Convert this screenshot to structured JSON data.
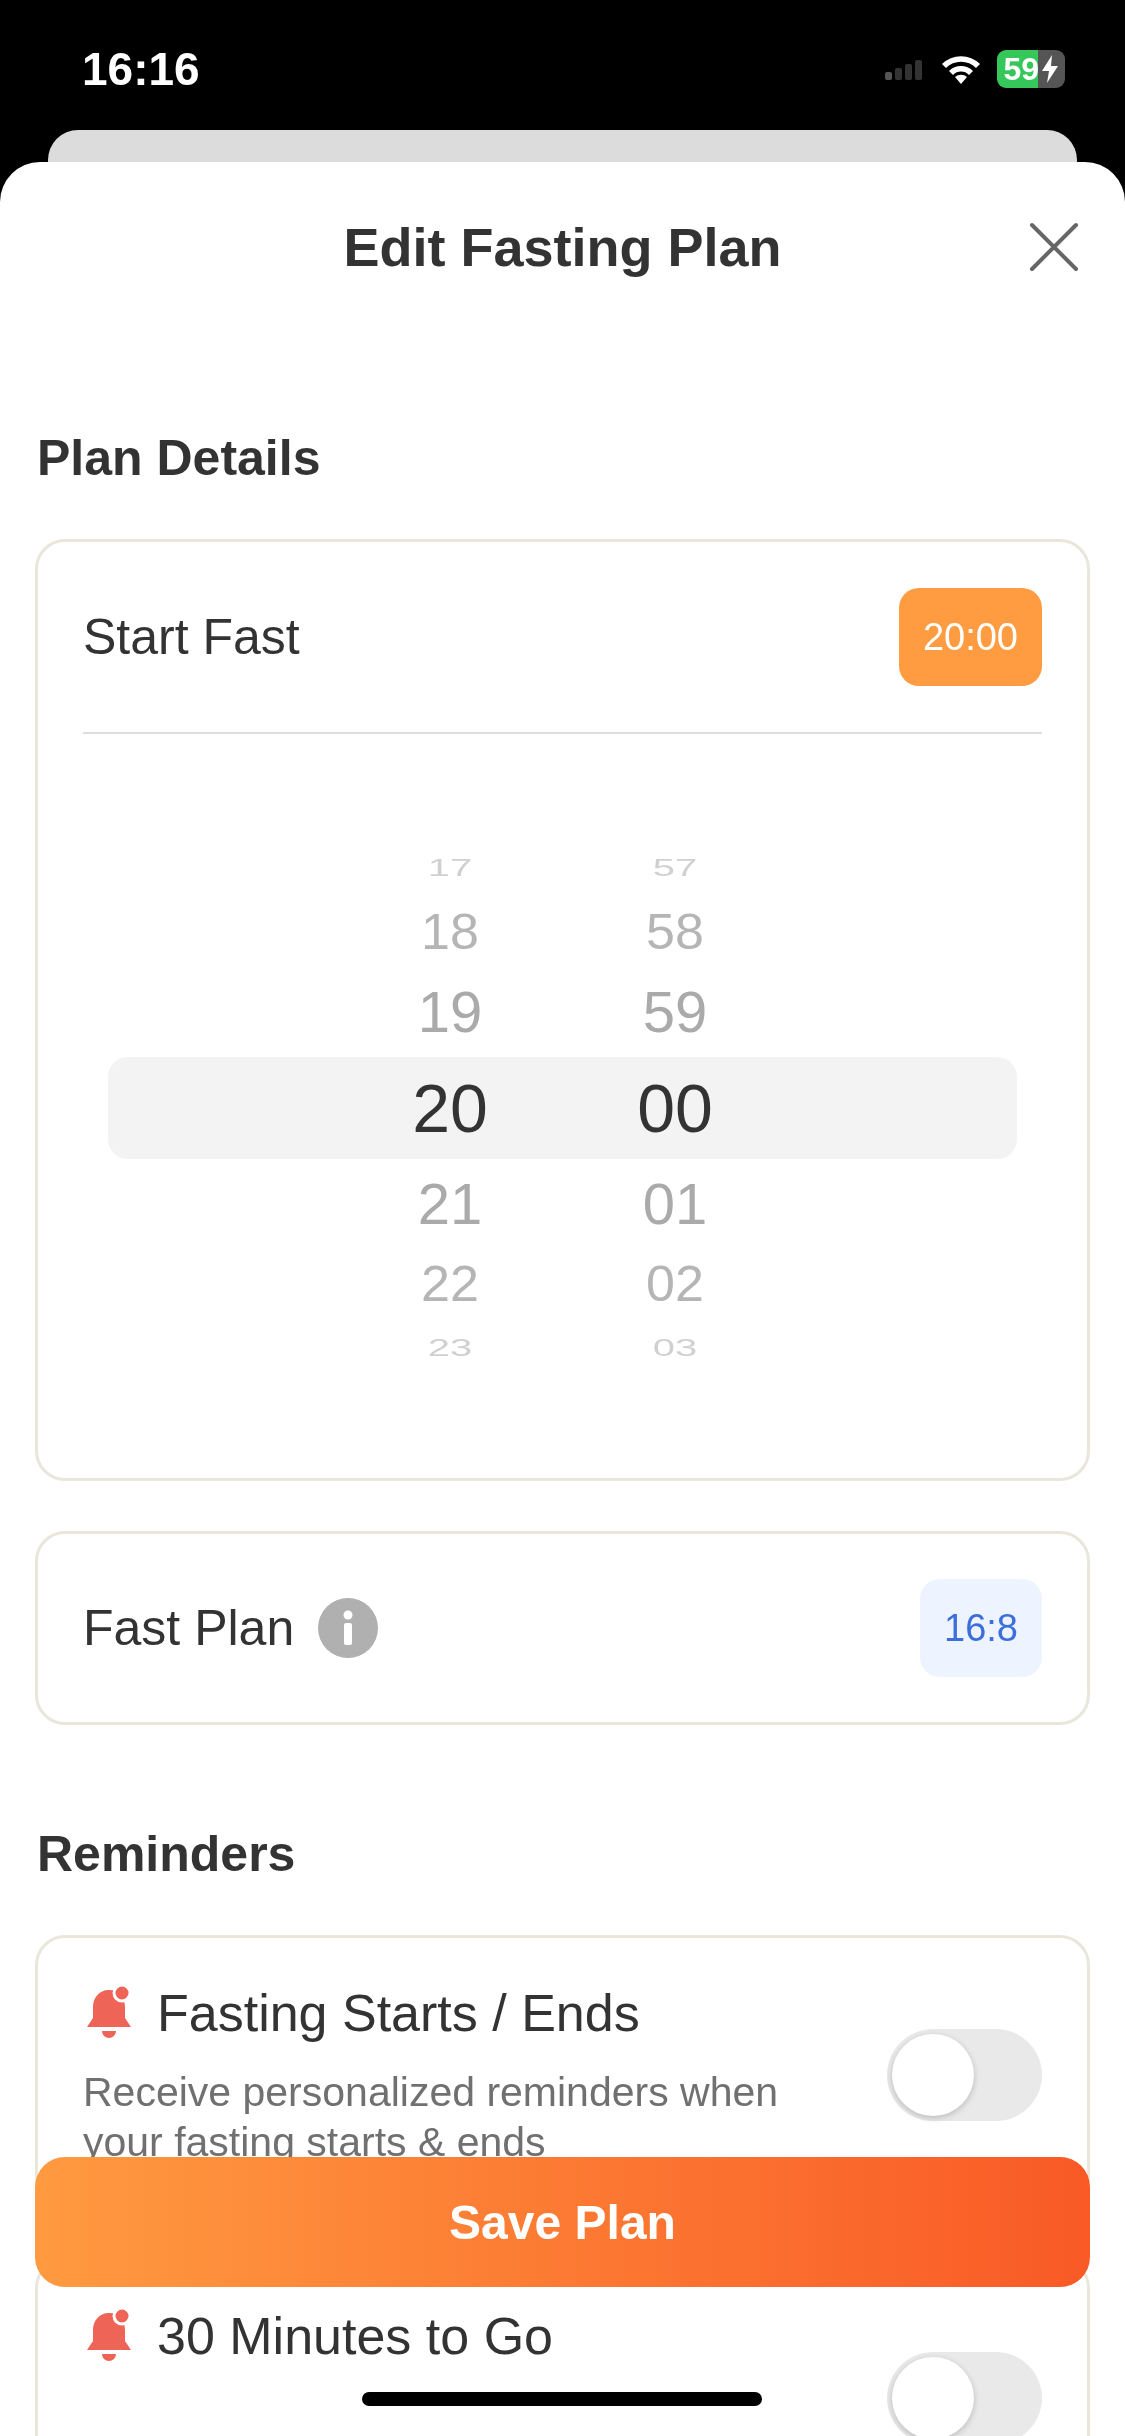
{
  "status_bar": {
    "time": "16:16",
    "battery": "59",
    "charging": true
  },
  "sheet": {
    "title": "Edit Fasting Plan"
  },
  "plan_details": {
    "heading": "Plan Details",
    "start_fast": {
      "label": "Start Fast",
      "value": "20:00"
    },
    "picker": {
      "hours": [
        {
          "value": "17",
          "selected": false
        },
        {
          "value": "18",
          "selected": false
        },
        {
          "value": "19",
          "selected": false
        },
        {
          "value": "20",
          "selected": true
        },
        {
          "value": "21",
          "selected": false
        },
        {
          "value": "22",
          "selected": false
        },
        {
          "value": "23",
          "selected": false
        }
      ],
      "minutes": [
        {
          "value": "57",
          "selected": false
        },
        {
          "value": "58",
          "selected": false
        },
        {
          "value": "59",
          "selected": false
        },
        {
          "value": "00",
          "selected": true
        },
        {
          "value": "01",
          "selected": false
        },
        {
          "value": "02",
          "selected": false
        },
        {
          "value": "03",
          "selected": false
        }
      ]
    },
    "fast_plan": {
      "label": "Fast Plan",
      "value": "16:8"
    }
  },
  "reminders": {
    "heading": "Reminders",
    "items": [
      {
        "title": "Fasting Starts / Ends",
        "description": "Receive personalized reminders when your fasting starts & ends",
        "on": false
      },
      {
        "title": "30 Minutes to Go",
        "on": false
      }
    ]
  },
  "save_button": "Save Plan"
}
